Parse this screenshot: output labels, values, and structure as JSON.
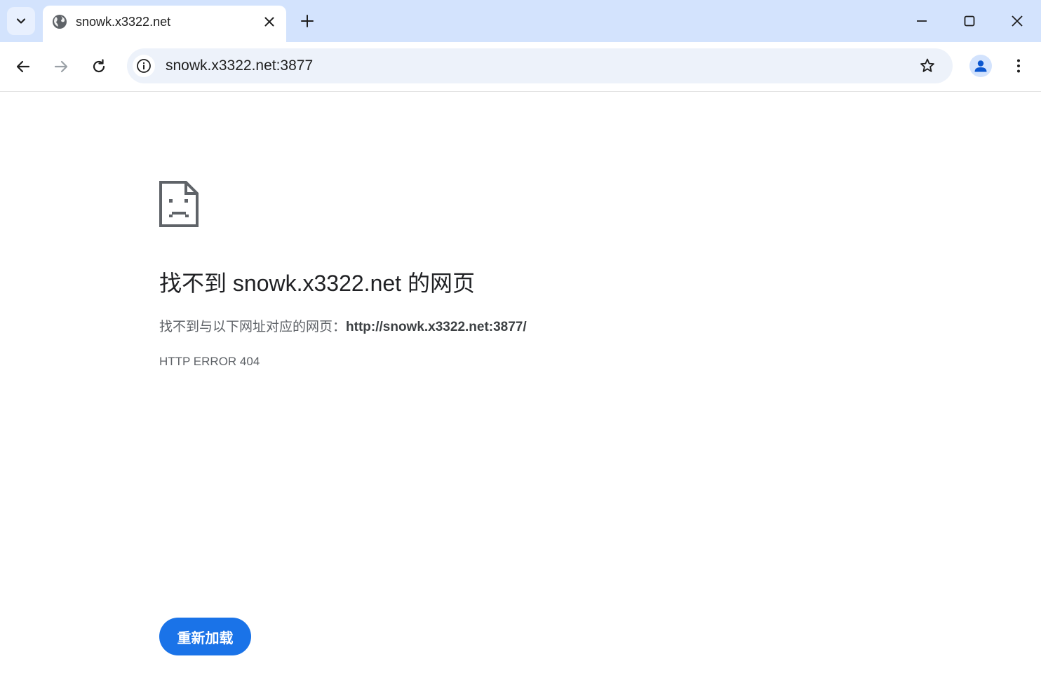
{
  "browser": {
    "tab": {
      "title": "snowk.x3322.net",
      "favicon": "globe-icon"
    },
    "address_bar": {
      "url": "snowk.x3322.net:3877"
    },
    "colors": {
      "titlebar": "#d3e3fd",
      "omnibox": "#edf2fa",
      "accent": "#1a73e8"
    }
  },
  "error_page": {
    "icon": "sad-document-icon",
    "heading": "找不到 snowk.x3322.net 的网页",
    "description_prefix": "找不到与以下网址对应的网页：",
    "description_url": "http://snowk.x3322.net:3877/",
    "error_code": "HTTP ERROR 404",
    "reload_label": "重新加载"
  }
}
